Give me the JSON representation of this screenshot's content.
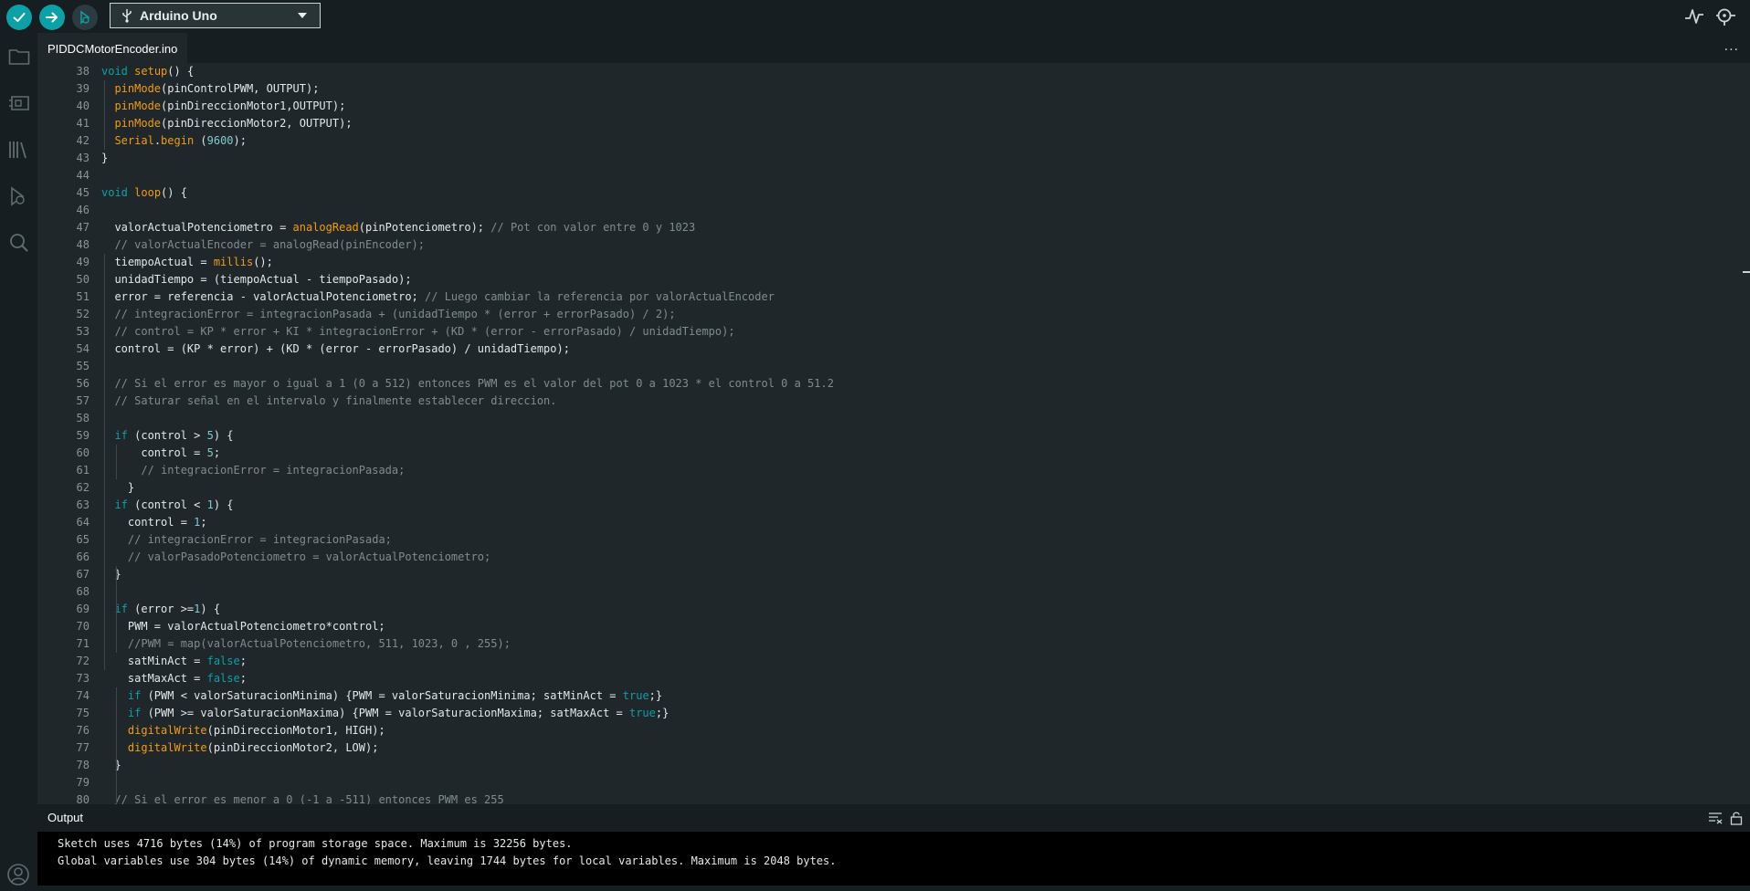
{
  "toolbar": {
    "board_label": "Arduino Uno",
    "icons": [
      "verify-icon",
      "upload-icon",
      "debug-icon",
      "usb-icon",
      "serial-plotter-icon",
      "serial-monitor-icon"
    ]
  },
  "sidebar": {
    "icons": [
      "folder-icon",
      "board-manager-icon",
      "library-icon",
      "debug-icon",
      "search-icon",
      "account-icon"
    ]
  },
  "tab": {
    "filename": "PIDDCMotorEncoder.ino",
    "more": "..."
  },
  "editor": {
    "line_numbers": [
      "38",
      "39",
      "40",
      "41",
      "42",
      "43",
      "44",
      "45",
      "46",
      "47",
      "48",
      "49",
      "50",
      "51",
      "52",
      "53",
      "54",
      "55",
      "56",
      "57",
      "58",
      "59",
      "60",
      "61",
      "62",
      "63",
      "64",
      "65",
      "66",
      "67",
      "68",
      "69",
      "70",
      "71",
      "72",
      "73",
      "74",
      "75",
      "76",
      "77",
      "78",
      "79",
      "80"
    ],
    "lines": [
      [
        [
          "kw",
          "void"
        ],
        [
          "t",
          " "
        ],
        [
          "fn",
          "setup"
        ],
        [
          "t",
          "() {"
        ]
      ],
      [
        [
          "t",
          "  "
        ],
        [
          "fn",
          "pinMode"
        ],
        [
          "t",
          "(pinControlPWM, OUTPUT);"
        ]
      ],
      [
        [
          "t",
          "  "
        ],
        [
          "fn",
          "pinMode"
        ],
        [
          "t",
          "(pinDireccionMotor1,OUTPUT);"
        ]
      ],
      [
        [
          "t",
          "  "
        ],
        [
          "fn",
          "pinMode"
        ],
        [
          "t",
          "(pinDireccionMotor2, OUTPUT);"
        ]
      ],
      [
        [
          "t",
          "  "
        ],
        [
          "fn",
          "Serial"
        ],
        [
          "t",
          "."
        ],
        [
          "fn",
          "begin"
        ],
        [
          "t",
          " ("
        ],
        [
          "nm",
          "9600"
        ],
        [
          "t",
          ");"
        ]
      ],
      [
        [
          "t",
          "}"
        ]
      ],
      [
        [
          "t",
          ""
        ]
      ],
      [
        [
          "kw",
          "void"
        ],
        [
          "t",
          " "
        ],
        [
          "fn",
          "loop"
        ],
        [
          "t",
          "() {"
        ]
      ],
      [
        [
          "t",
          ""
        ]
      ],
      [
        [
          "t",
          "  valorActualPotenciometro = "
        ],
        [
          "fn",
          "analogRead"
        ],
        [
          "t",
          "(pinPotenciometro); "
        ],
        [
          "cm",
          "// Pot con valor entre 0 y 1023"
        ]
      ],
      [
        [
          "t",
          "  "
        ],
        [
          "cm",
          "// valorActualEncoder = analogRead(pinEncoder);"
        ]
      ],
      [
        [
          "t",
          "  tiempoActual = "
        ],
        [
          "fn",
          "millis"
        ],
        [
          "t",
          "();"
        ]
      ],
      [
        [
          "t",
          "  unidadTiempo = (tiempoActual - tiempoPasado);"
        ]
      ],
      [
        [
          "t",
          "  error = referencia - valorActualPotenciometro; "
        ],
        [
          "cm",
          "// Luego cambiar la referencia por valorActualEncoder"
        ]
      ],
      [
        [
          "t",
          "  "
        ],
        [
          "cm",
          "// integracionError = integracionPasada + (unidadTiempo * (error + errorPasado) / 2);"
        ]
      ],
      [
        [
          "t",
          "  "
        ],
        [
          "cm",
          "// control = KP * error + KI * integracionError + (KD * (error - errorPasado) / unidadTiempo);"
        ]
      ],
      [
        [
          "t",
          "  control = (KP * error) + (KD * (error - errorPasado) / unidadTiempo);"
        ]
      ],
      [
        [
          "t",
          ""
        ]
      ],
      [
        [
          "t",
          "  "
        ],
        [
          "cm",
          "// Si el error es mayor o igual a 1 (0 a 512) entonces PWM es el valor del pot 0 a 1023 * el control 0 a 51.2"
        ]
      ],
      [
        [
          "t",
          "  "
        ],
        [
          "cm",
          "// Saturar señal en el intervalo y finalmente establecer direccion."
        ]
      ],
      [
        [
          "t",
          ""
        ]
      ],
      [
        [
          "t",
          "  "
        ],
        [
          "kw",
          "if"
        ],
        [
          "t",
          " (control > "
        ],
        [
          "nm",
          "5"
        ],
        [
          "t",
          ") {"
        ]
      ],
      [
        [
          "t",
          "      control = "
        ],
        [
          "nm",
          "5"
        ],
        [
          "t",
          ";"
        ]
      ],
      [
        [
          "t",
          "      "
        ],
        [
          "cm",
          "// integracionError = integracionPasada;"
        ]
      ],
      [
        [
          "t",
          "    }"
        ]
      ],
      [
        [
          "t",
          "  "
        ],
        [
          "kw",
          "if"
        ],
        [
          "t",
          " (control < "
        ],
        [
          "nm",
          "1"
        ],
        [
          "t",
          ") {"
        ]
      ],
      [
        [
          "t",
          "    control = "
        ],
        [
          "nm",
          "1"
        ],
        [
          "t",
          ";"
        ]
      ],
      [
        [
          "t",
          "    "
        ],
        [
          "cm",
          "// integracionError = integracionPasada;"
        ]
      ],
      [
        [
          "t",
          "    "
        ],
        [
          "cm",
          "// valorPasadoPotenciometro = valorActualPotenciometro;"
        ]
      ],
      [
        [
          "t",
          "  }"
        ]
      ],
      [
        [
          "t",
          ""
        ]
      ],
      [
        [
          "t",
          "  "
        ],
        [
          "kw",
          "if"
        ],
        [
          "t",
          " (error >="
        ],
        [
          "nm",
          "1"
        ],
        [
          "t",
          ") {"
        ]
      ],
      [
        [
          "t",
          "    PWM = valorActualPotenciometro*control;"
        ]
      ],
      [
        [
          "t",
          "    "
        ],
        [
          "cm",
          "//PWM = map(valorActualPotenciometro, 511, 1023, 0 , 255);"
        ]
      ],
      [
        [
          "t",
          "    satMinAct = "
        ],
        [
          "kw",
          "false"
        ],
        [
          "t",
          ";"
        ]
      ],
      [
        [
          "t",
          "    satMaxAct = "
        ],
        [
          "kw",
          "false"
        ],
        [
          "t",
          ";"
        ]
      ],
      [
        [
          "t",
          "    "
        ],
        [
          "kw",
          "if"
        ],
        [
          "t",
          " (PWM < valorSaturacionMinima) {PWM = valorSaturacionMinima; satMinAct = "
        ],
        [
          "kw",
          "true"
        ],
        [
          "t",
          ";}"
        ]
      ],
      [
        [
          "t",
          "    "
        ],
        [
          "kw",
          "if"
        ],
        [
          "t",
          " (PWM >= valorSaturacionMaxima) {PWM = valorSaturacionMaxima; satMaxAct = "
        ],
        [
          "kw",
          "true"
        ],
        [
          "t",
          ";}"
        ]
      ],
      [
        [
          "t",
          "    "
        ],
        [
          "fn",
          "digitalWrite"
        ],
        [
          "t",
          "(pinDireccionMotor1, HIGH);"
        ]
      ],
      [
        [
          "t",
          "    "
        ],
        [
          "fn",
          "digitalWrite"
        ],
        [
          "t",
          "(pinDireccionMotor2, LOW);"
        ]
      ],
      [
        [
          "t",
          "  }"
        ]
      ],
      [
        [
          "t",
          ""
        ]
      ],
      [
        [
          "t",
          "  "
        ],
        [
          "cm",
          "// Si el error es menor a 0 (-1 a -511) entonces PWM es 255"
        ]
      ]
    ]
  },
  "output": {
    "title": "Output",
    "lines": [
      "Sketch uses 4716 bytes (14%) of program storage space. Maximum is 32256 bytes.",
      "Global variables use 304 bytes (14%) of dynamic memory, leaving 1744 bytes for local variables. Maximum is 2048 bytes."
    ]
  },
  "colors": {
    "accent": "#0ca1a6",
    "function": "#f39c12",
    "comment": "#7f8c8d",
    "editor_bg": "#1f272a",
    "chrome_bg": "#171e21"
  }
}
